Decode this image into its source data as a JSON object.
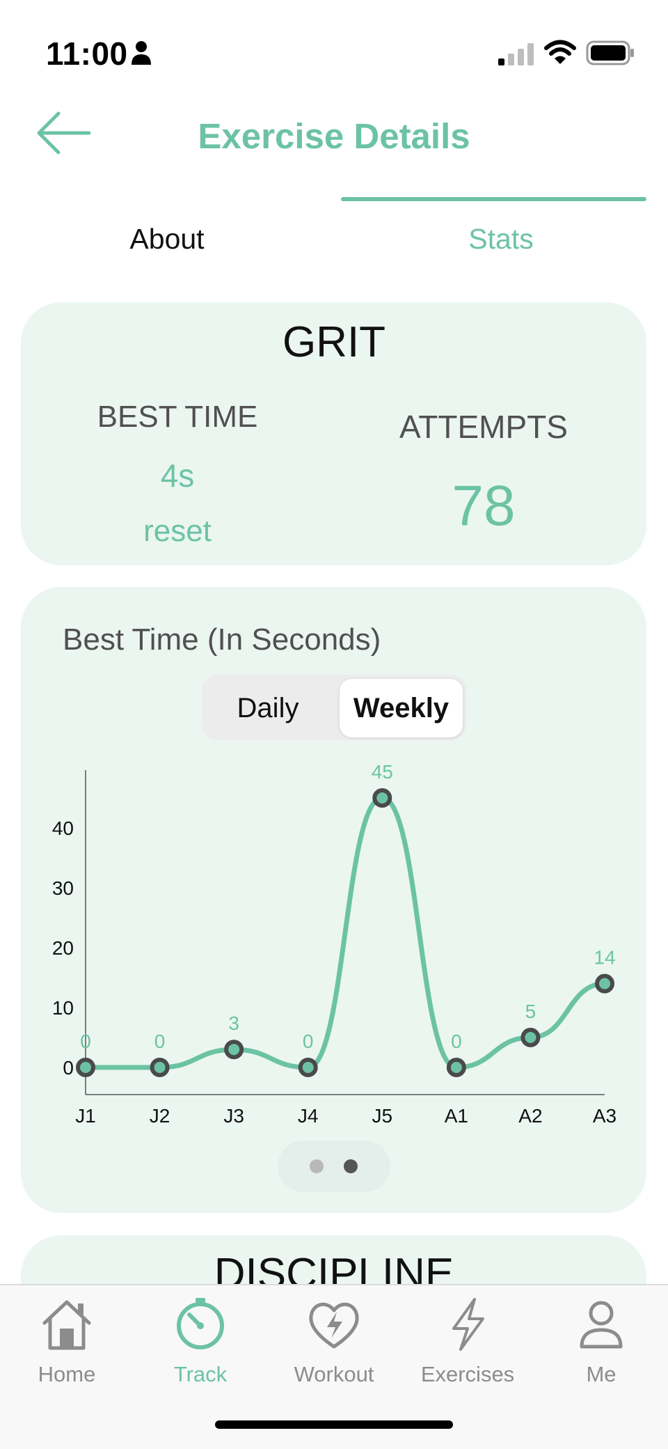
{
  "status_bar": {
    "time": "11:00"
  },
  "header": {
    "title": "Exercise Details"
  },
  "tabs": [
    {
      "label": "About"
    },
    {
      "label": "Stats"
    }
  ],
  "summary": {
    "exercise_name": "GRIT",
    "best_time_label": "BEST TIME",
    "best_time_value": "4s",
    "reset_label": "reset",
    "attempts_label": "ATTEMPTS",
    "attempts_value": "78"
  },
  "chart_section": {
    "title": "Best Time (In Seconds)",
    "toggle": {
      "options": [
        "Daily",
        "Weekly"
      ],
      "selected": "Weekly"
    },
    "pager": {
      "pages": 2,
      "current": 2
    }
  },
  "chart_data": {
    "type": "line",
    "categories": [
      "J1",
      "J2",
      "J3",
      "J4",
      "J5",
      "A1",
      "A2",
      "A3"
    ],
    "values": [
      0,
      0,
      3,
      0,
      45,
      0,
      5,
      14
    ],
    "ylim": [
      0,
      45
    ],
    "yticks": [
      0,
      10,
      20,
      30,
      40
    ],
    "line_color": "#6cc3a4",
    "marker_color": "#4a4a4a",
    "smooth": true,
    "data_labels": true
  },
  "next_card": {
    "title": "DISCIPLINE"
  },
  "bottom_nav": {
    "items": [
      {
        "label": "Home",
        "icon": "home-icon"
      },
      {
        "label": "Track",
        "icon": "stopwatch-icon"
      },
      {
        "label": "Workout",
        "icon": "heart-bolt-icon"
      },
      {
        "label": "Exercises",
        "icon": "bolt-icon"
      },
      {
        "label": "Me",
        "icon": "person-icon"
      }
    ],
    "active": "Track"
  },
  "colors": {
    "accent": "#6cc3a4",
    "card_bg": "#ebf6f1",
    "text_muted": "#505050"
  }
}
